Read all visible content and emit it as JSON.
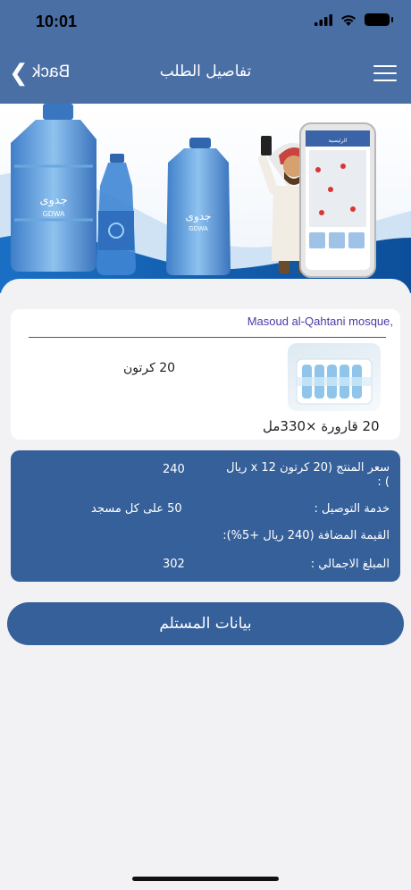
{
  "status_bar": {
    "time": "10:01"
  },
  "nav": {
    "back_label": "Back",
    "title": "تفاصيل الطلب"
  },
  "banner": {
    "brand_arabic": "جدوى",
    "brand_latin": "GDWA",
    "phone_screen_title": "الرئيسية"
  },
  "order": {
    "address": "Masoud al-Qahtani mosque,",
    "product_quantity": "20 كرتون",
    "product_description": "20 قارورة ×330مل"
  },
  "pricing": {
    "product_price_label": "سعر المنتج (20 كرتون x 12 ريال )",
    "product_price_label_line1": "سعر المنتج (20 كرتون x 12 ريال",
    "product_price_label_line2": ") :",
    "product_price_value": "240",
    "delivery_label": "خدمة التوصيل :",
    "delivery_value": "50 على كل مسجد",
    "vat_label": "القيمة المضافة (240 ريال +5%):",
    "total_label": "المبلغ الاجمالي :",
    "total_value": "302"
  },
  "actions": {
    "receiver_button": "بيانات المستلم"
  },
  "colors": {
    "header": "#4a6fa5",
    "card_blue": "#36609a",
    "address_text": "#4b3aa6",
    "background": "#f2f2f4"
  }
}
